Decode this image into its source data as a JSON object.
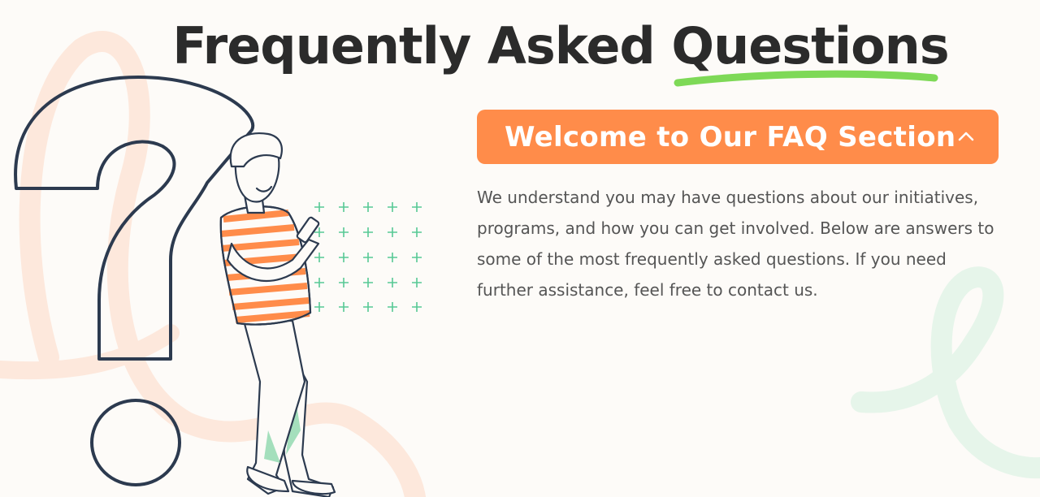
{
  "page": {
    "title": "Frequently Asked Questions"
  },
  "faq": {
    "items": [
      {
        "question": "Welcome to Our FAQ Section",
        "expanded": true,
        "answer": "We understand you may have questions about our initiatives, programs, and how you can get involved. Below are answers to some of the most frequently asked questions. If you need further assistance, feel free to contact us."
      }
    ]
  },
  "icons": {
    "toggle": "chevron-up-icon"
  },
  "colors": {
    "accent": "#ff8c4a",
    "underline": "#7ed957",
    "text": "#2b2b2b",
    "body_text": "#555555",
    "background": "#fdfbf8"
  }
}
